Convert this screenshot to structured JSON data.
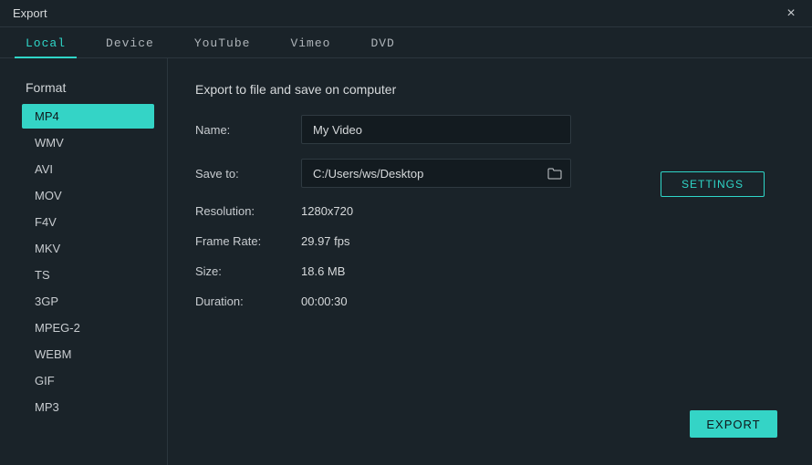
{
  "window": {
    "title": "Export"
  },
  "tabs": [
    {
      "label": "Local",
      "active": true
    },
    {
      "label": "Device",
      "active": false
    },
    {
      "label": "YouTube",
      "active": false
    },
    {
      "label": "Vimeo",
      "active": false
    },
    {
      "label": "DVD",
      "active": false
    }
  ],
  "sidebar": {
    "title": "Format",
    "formats": [
      {
        "label": "MP4",
        "selected": true
      },
      {
        "label": "WMV",
        "selected": false
      },
      {
        "label": "AVI",
        "selected": false
      },
      {
        "label": "MOV",
        "selected": false
      },
      {
        "label": "F4V",
        "selected": false
      },
      {
        "label": "MKV",
        "selected": false
      },
      {
        "label": "TS",
        "selected": false
      },
      {
        "label": "3GP",
        "selected": false
      },
      {
        "label": "MPEG-2",
        "selected": false
      },
      {
        "label": "WEBM",
        "selected": false
      },
      {
        "label": "GIF",
        "selected": false
      },
      {
        "label": "MP3",
        "selected": false
      }
    ]
  },
  "main": {
    "title": "Export to file and save on computer",
    "name_label": "Name:",
    "name_value": "My Video",
    "saveto_label": "Save to:",
    "saveto_value": "C:/Users/ws/Desktop",
    "resolution_label": "Resolution:",
    "resolution_value": "1280x720",
    "framerate_label": "Frame Rate:",
    "framerate_value": "29.97 fps",
    "size_label": "Size:",
    "size_value": "18.6 MB",
    "duration_label": "Duration:",
    "duration_value": "00:00:30",
    "settings_button": "SETTINGS",
    "export_button": "EXPORT"
  }
}
